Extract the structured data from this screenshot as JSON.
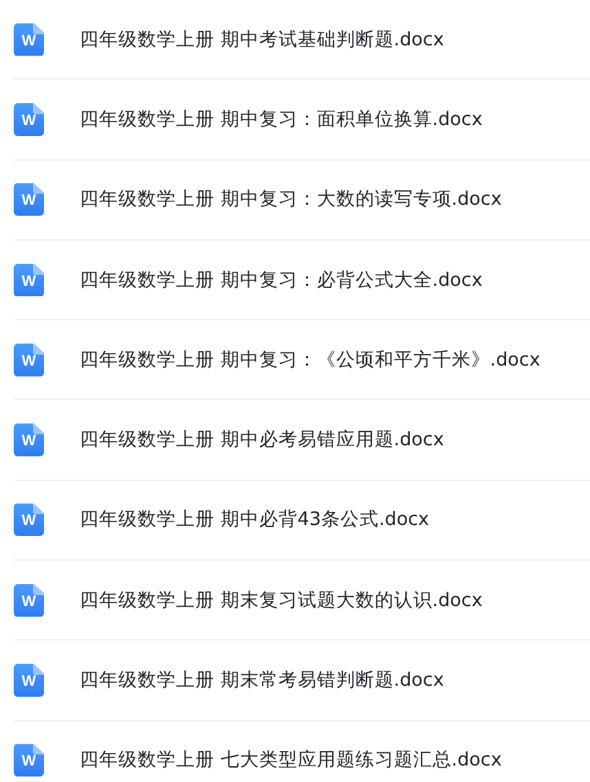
{
  "files": [
    {
      "icon_letter": "W",
      "name": "四年级数学上册 期中考试基础判断题.docx"
    },
    {
      "icon_letter": "W",
      "name": "四年级数学上册 期中复习：面积单位换算.docx"
    },
    {
      "icon_letter": "W",
      "name": "四年级数学上册 期中复习：大数的读写专项.docx"
    },
    {
      "icon_letter": "W",
      "name": "四年级数学上册 期中复习：必背公式大全.docx"
    },
    {
      "icon_letter": "W",
      "name": "四年级数学上册 期中复习：《公顷和平方千米》.docx"
    },
    {
      "icon_letter": "W",
      "name": "四年级数学上册 期中必考易错应用题.docx"
    },
    {
      "icon_letter": "W",
      "name": "四年级数学上册 期中必背43条公式.docx"
    },
    {
      "icon_letter": "W",
      "name": "四年级数学上册 期末复习试题大数的认识.docx"
    },
    {
      "icon_letter": "W",
      "name": "四年级数学上册 期末常考易错判断题.docx"
    },
    {
      "icon_letter": "W",
      "name": "四年级数学上册 七大类型应用题练习题汇总.docx"
    }
  ]
}
